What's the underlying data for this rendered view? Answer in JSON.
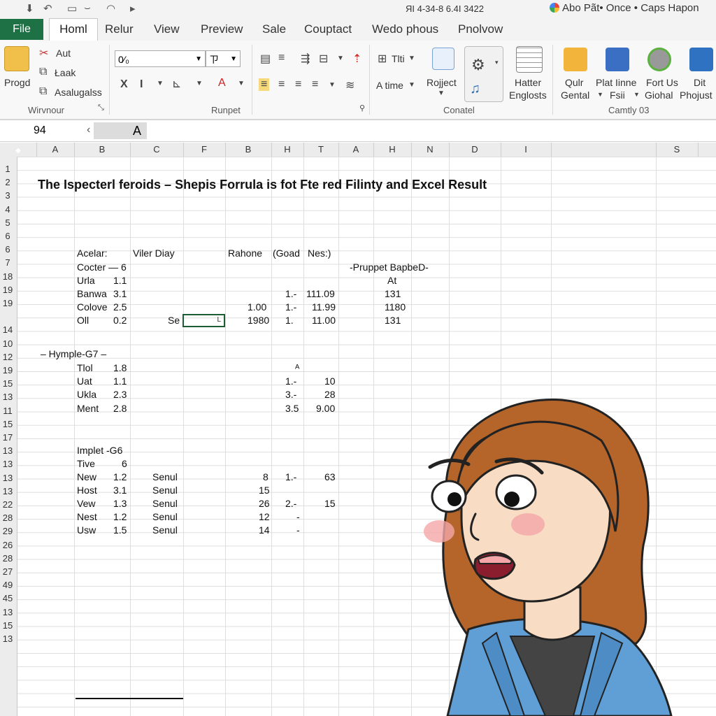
{
  "titlebar": {
    "center_text": "ЯІ 4-34-8 6.4I 3422",
    "right_text": "Abo Pãt• Once • Caps Hapon"
  },
  "tabs": {
    "file": "File",
    "active": "Homl",
    "items": [
      "Relur",
      "View",
      "Preview",
      "Sale",
      "Couptact",
      "Wedo phous",
      "Pnolvow"
    ]
  },
  "ribbon": {
    "clipboard": {
      "big": "Progd",
      "items": [
        "Aut",
        "Łaak",
        "Asalugalss"
      ],
      "group": "Wirvnour"
    },
    "font": {
      "font_box": "0⁄₀",
      "size_box": "ㄗ",
      "group": "Runpet"
    },
    "align": {
      "atime": "A time",
      "tint": "Tlti",
      "group": "Conatel"
    },
    "project": {
      "label": "Rojject"
    },
    "hatter": {
      "label1": "Hatter",
      "label2": "Englosts"
    },
    "right_group": {
      "items": [
        {
          "l1": "Qulr",
          "l2": "Gental"
        },
        {
          "l1": "Plat Iinne",
          "l2": "Fsii"
        },
        {
          "l1": "Fort Us",
          "l2": "Giohal"
        },
        {
          "l1": "Dit",
          "l2": "Phojust"
        }
      ],
      "group": "Camtly 03"
    }
  },
  "formula_bar": {
    "name_box": "94",
    "fx": "A"
  },
  "columns": [
    "A",
    "B",
    "C",
    "F",
    "В",
    "H",
    "T",
    "A",
    "H",
    "N",
    "D",
    "I",
    "",
    "S"
  ],
  "rows": [
    "1",
    "2",
    "3",
    "4",
    "5",
    "6",
    "6",
    "7",
    "18",
    "19",
    "19",
    "",
    "14",
    "10",
    "12",
    "19",
    "15",
    "13",
    "11",
    "15",
    "17",
    "13",
    "13",
    "13",
    "13",
    "22",
    "28",
    "29",
    "26",
    "28",
    "27",
    "49",
    "45",
    "13",
    "15",
    "13"
  ],
  "sheet": {
    "title": "The Ispecterl feroids – Shepis Forrula is fot Fte red Filinty and Excel Result",
    "header": {
      "a": "Acelar:",
      "b": "Viler Diay",
      "c": "Rahone",
      "d": "(Goad",
      "e": "Nes:)"
    },
    "group1": {
      "rows": [
        {
          "name": "Cocter — 6",
          "val": "",
          "c1": "",
          "c2": "",
          "c3": "",
          "c4": "-Pruppet BapbeD-"
        },
        {
          "name": "Urla",
          "val": "1.1",
          "c1": "",
          "c2": "",
          "c3": "",
          "c4": "At"
        },
        {
          "name": "Banwa",
          "val": "3.1",
          "c1": "",
          "c2": "1.-",
          "c3": "111.09",
          "c4": "131"
        },
        {
          "name": "Colove",
          "val": "2.5",
          "c1": "1.00",
          "c2": "1.-",
          "c3": "11.99",
          "c4": "1180"
        },
        {
          "name": "Oll",
          "val": "0.2",
          "c1": "1980",
          "c2": "1.",
          "c3": "11.00",
          "c4": "131"
        }
      ],
      "sel_prefix": "Se",
      "sel_text": "L"
    },
    "group2": {
      "heading": "– Hymple-G7 –",
      "rows": [
        {
          "name": "Tlol",
          "val": "1.8",
          "c2": "ᴬ",
          "c3": ""
        },
        {
          "name": "Uat",
          "val": "1.1",
          "c2": "1.-",
          "c3": "10"
        },
        {
          "name": "Ukla",
          "val": "2.3",
          "c2": "3.-",
          "c3": "28"
        },
        {
          "name": "Ment",
          "val": "2.8",
          "c2": "3.5",
          "c3": "9.00"
        }
      ]
    },
    "group3": {
      "heading": "Implet -G6",
      "rows": [
        {
          "name": "Tive",
          "val": "6",
          "s": "",
          "c1": "",
          "c2": "",
          "c3": ""
        },
        {
          "name": "New",
          "val": "1.2",
          "s": "Senul",
          "c1": "8",
          "c2": "1.-",
          "c3": "63"
        },
        {
          "name": "Host",
          "val": "3.1",
          "s": "Senul",
          "c1": "15",
          "c2": "",
          "c3": ""
        },
        {
          "name": "Vew",
          "val": "1.3",
          "s": "Senul",
          "c1": "26",
          "c2": "2.-",
          "c3": "15"
        },
        {
          "name": "Nest",
          "val": "1.2",
          "s": "Senul",
          "c1": "12",
          "c2": "-",
          "c3": ""
        },
        {
          "name": "Usw",
          "val": "1.5",
          "s": "Senul",
          "c1": "14",
          "c2": "-",
          "c3": ""
        }
      ]
    }
  },
  "colors": {
    "file_tab": "#1e7145",
    "selection": "#1e5c36",
    "hair": "#b5642a",
    "jacket": "#5f9fd6",
    "skin": "#f8dcc4"
  }
}
